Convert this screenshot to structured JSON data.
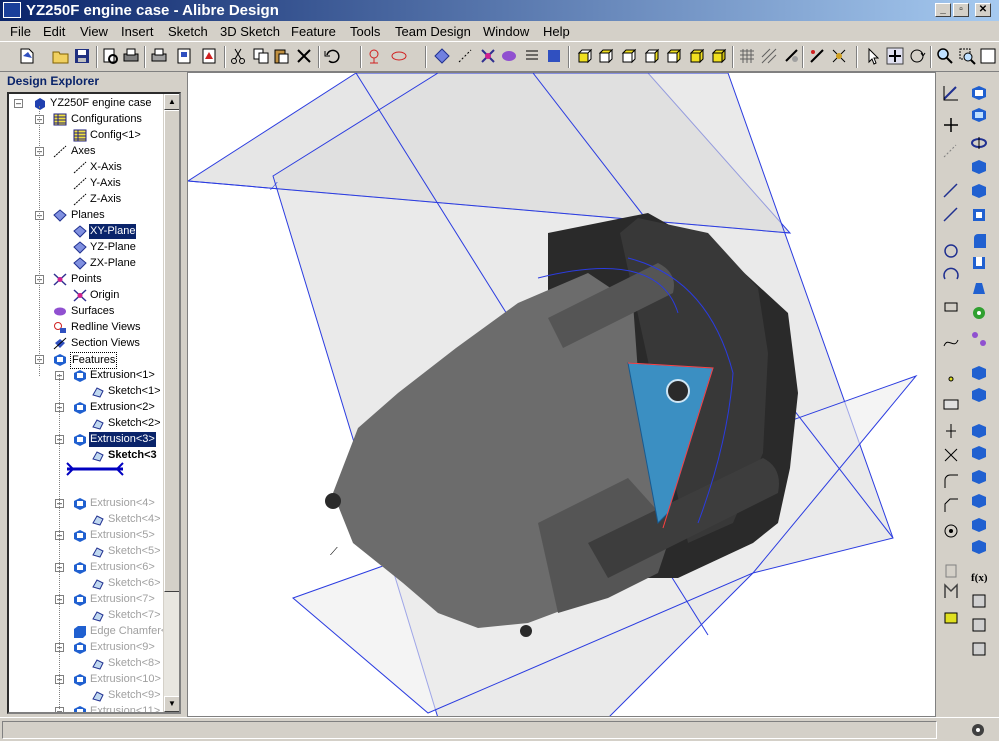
{
  "window": {
    "title": "YZ250F engine case - Alibre Design",
    "min": "_",
    "restore": "▫",
    "close": "✕"
  },
  "menu": [
    "File",
    "Edit",
    "View",
    "Insert",
    "Sketch",
    "3D Sketch",
    "Feature",
    "Tools",
    "Team Design",
    "Window",
    "Help"
  ],
  "explorer": {
    "title": "Design Explorer",
    "nodes": [
      {
        "label": "YZ250F engine case"
      },
      {
        "label": "Configurations"
      },
      {
        "label": "Config<1>"
      },
      {
        "label": "Axes"
      },
      {
        "label": "X-Axis"
      },
      {
        "label": "Y-Axis"
      },
      {
        "label": "Z-Axis"
      },
      {
        "label": "Planes"
      },
      {
        "label": "XY-Plane"
      },
      {
        "label": "YZ-Plane"
      },
      {
        "label": "ZX-Plane"
      },
      {
        "label": "Points"
      },
      {
        "label": "Origin"
      },
      {
        "label": "Surfaces"
      },
      {
        "label": "Redline Views"
      },
      {
        "label": "Section Views"
      },
      {
        "label": "Features"
      },
      {
        "label": "Extrusion<1>"
      },
      {
        "label": "Sketch<1>"
      },
      {
        "label": "Extrusion<2>"
      },
      {
        "label": "Sketch<2>"
      },
      {
        "label": "Extrusion<3>"
      },
      {
        "label": "Sketch<3"
      },
      {
        "label": "Extrusion<4>"
      },
      {
        "label": "Sketch<4>"
      },
      {
        "label": "Extrusion<5>"
      },
      {
        "label": "Sketch<5>"
      },
      {
        "label": "Extrusion<6>"
      },
      {
        "label": "Sketch<6>"
      },
      {
        "label": "Extrusion<7>"
      },
      {
        "label": "Sketch<7>"
      },
      {
        "label": "Edge Chamfer<"
      },
      {
        "label": "Extrusion<9>"
      },
      {
        "label": "Sketch<8>"
      },
      {
        "label": "Extrusion<10>"
      },
      {
        "label": "Sketch<9>"
      },
      {
        "label": "Extrusion<11>"
      }
    ]
  },
  "toolbar_icons": [
    "new-icon",
    "open-icon",
    "save-icon",
    "print-preview-icon",
    "print-icon",
    "pdf-icon",
    "cut-icon",
    "copy-icon",
    "delete-icon",
    "undo-icon",
    "redline-icon",
    "plane-icon",
    "axis-icon",
    "point-icon",
    "view-front-icon",
    "view-back-icon",
    "view-top-icon",
    "view-bottom-icon",
    "view-left-icon",
    "view-right-icon",
    "select-icon",
    "zoom-icon"
  ],
  "right_toolbar_icons": [
    "sketch-icon",
    "line-icon",
    "circle-icon",
    "arc-icon",
    "rectangle-icon",
    "spline-icon",
    "point-icon",
    "dimension-icon",
    "trim-icon",
    "fillet-icon",
    "extrude-icon",
    "revolve-icon",
    "shell-icon",
    "mirror-icon",
    "equation-icon"
  ],
  "colors": {
    "title_start": "#0a246a",
    "title_end": "#a6caf0",
    "part_grey": "#606060",
    "face_blue": "#3b8fc2",
    "plane_blue": "#2b3ce0"
  }
}
